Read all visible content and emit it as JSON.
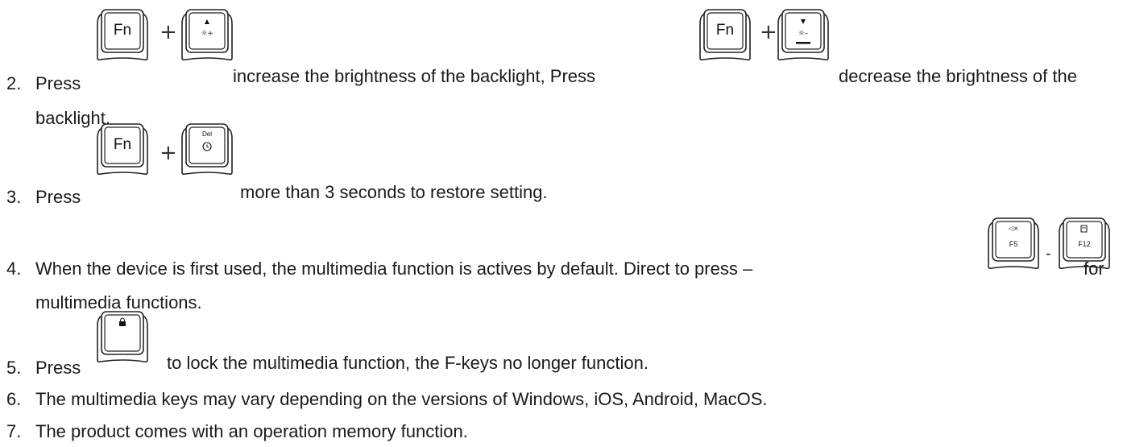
{
  "items": [
    {
      "num": "2.",
      "press": "Press",
      "mid": "increase the brightness of the backlight, Press",
      "end": "decrease the brightness of the",
      "cont": "backlight."
    },
    {
      "num": "3.",
      "press": "Press",
      "end": "more than 3 seconds to restore setting."
    },
    {
      "num": "4.",
      "text": "When the device is first used, the multimedia function is actives by default. Direct to press –",
      "separator": "-",
      "end": "for",
      "cont": "multimedia functions."
    },
    {
      "num": "5.",
      "press": "Press",
      "end": "to lock the multimedia function, the F-keys no longer function."
    },
    {
      "num": "6.",
      "text": "The multimedia keys may vary depending on the versions of Windows, iOS, Android, MacOS."
    },
    {
      "num": "7.",
      "text": "The product comes with an operation memory function."
    }
  ],
  "keys": {
    "fn": "Fn",
    "plus": "+",
    "up_arrow": "▲",
    "down_arrow": "▼",
    "brightness_up": "☼+",
    "brightness_down": "☼–",
    "del": "Del",
    "f5": "F5",
    "f12": "F12",
    "mute": "◁×"
  },
  "icons": [
    "fn-key-icon",
    "brightness-up-key-icon",
    "brightness-down-key-icon",
    "delete-restore-key-icon",
    "f5-mute-key-icon",
    "f12-key-icon",
    "fn-lock-key-icon"
  ]
}
